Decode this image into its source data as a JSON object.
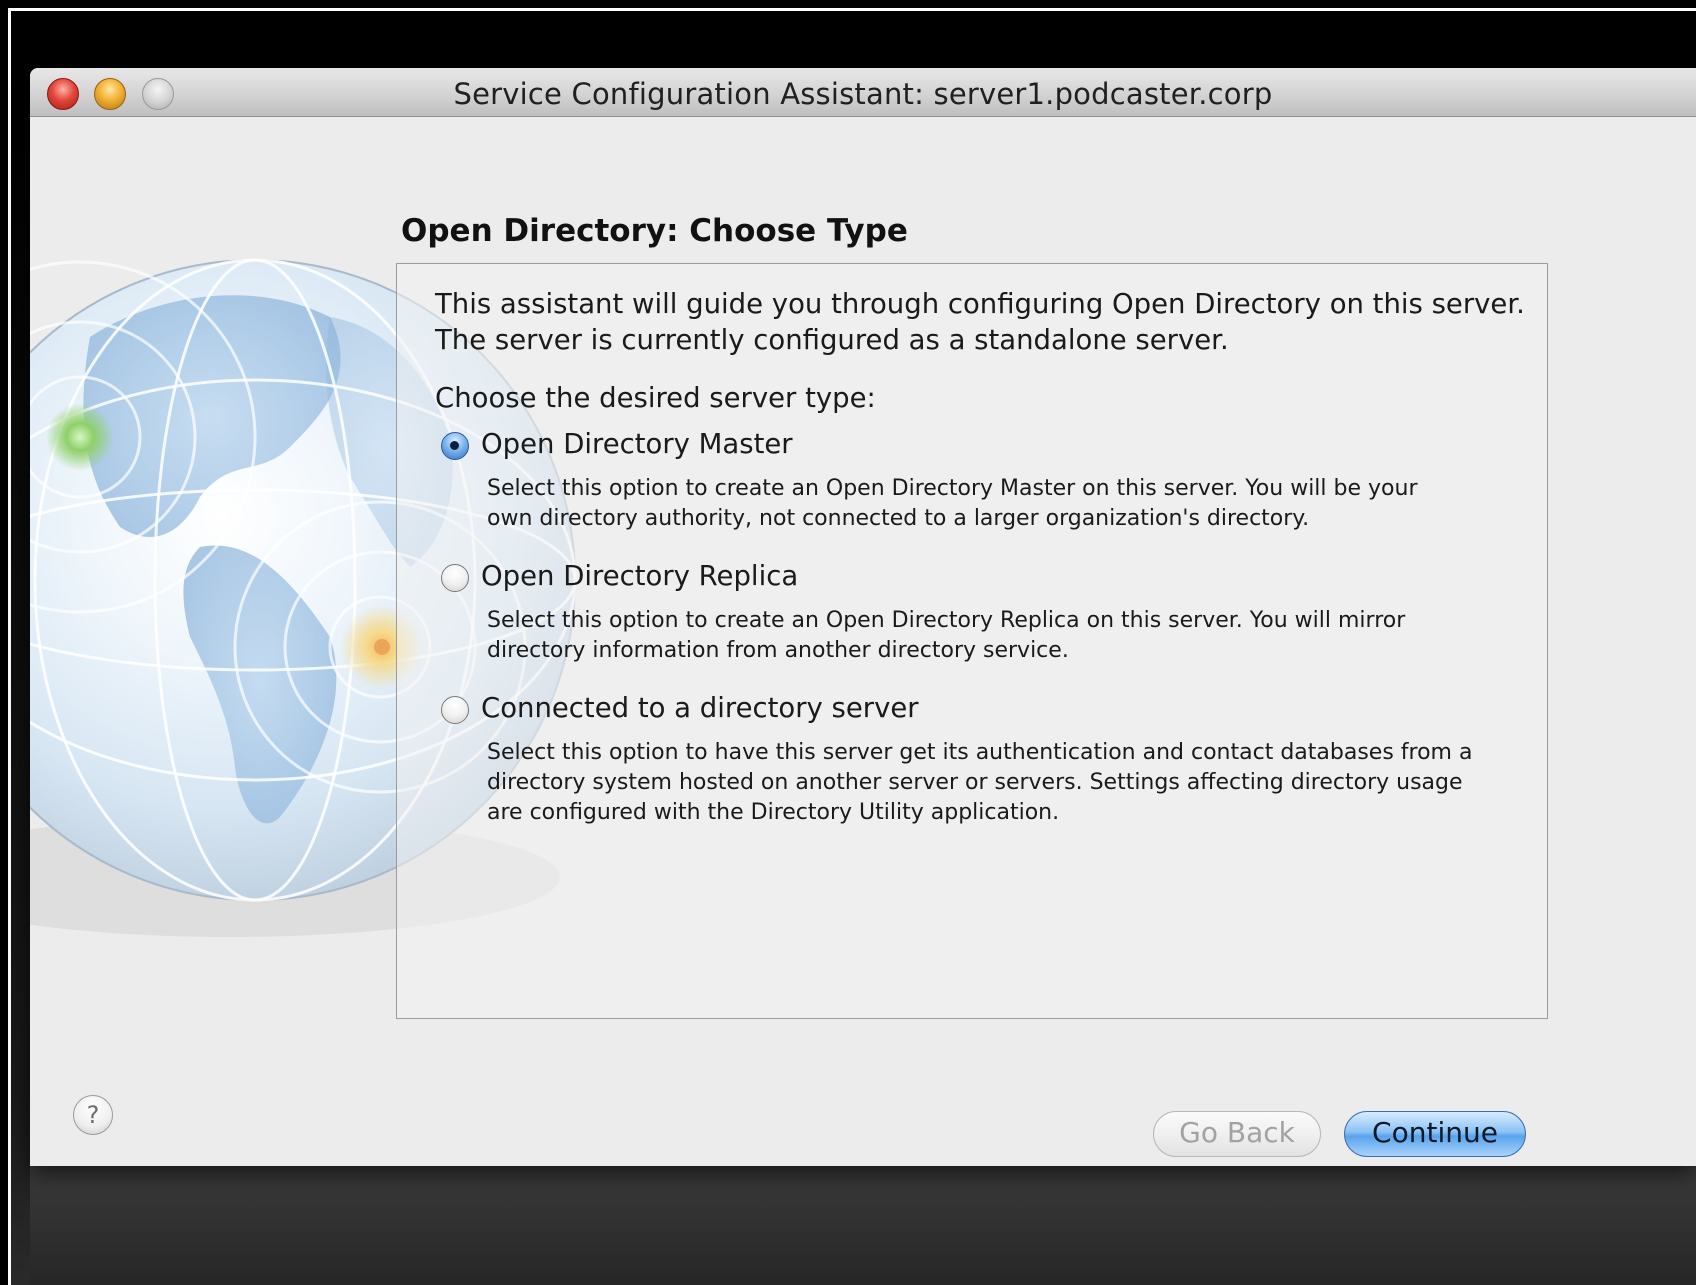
{
  "window": {
    "title": "Service Configuration Assistant: server1.podcaster.corp"
  },
  "page": {
    "title": "Open Directory: Choose Type",
    "intro_line1": "This assistant will guide you through configuring Open Directory on this server.",
    "intro_line2": "The server is currently configured as a standalone server.",
    "choose_label": "Choose the desired server type:"
  },
  "options": [
    {
      "label": "Open Directory Master",
      "selected": true,
      "desc_line1": "Select this option to create an Open Directory Master on this server.  You will be your",
      "desc_line2": "own directory authority, not connected to a larger organization's directory."
    },
    {
      "label": "Open Directory Replica",
      "selected": false,
      "desc_line1": "Select this option to create an Open Directory Replica on this server.  You will mirror",
      "desc_line2": "directory information from another directory service."
    },
    {
      "label": "Connected to a directory server",
      "selected": false,
      "desc_line1": "Select this option to have this server get its authentication and contact databases from a",
      "desc_line2": "directory system hosted on another server or servers.  Settings affecting directory usage",
      "desc_line3": "are configured with the Directory Utility application."
    }
  ],
  "footer": {
    "help_glyph": "?",
    "back_label": "Go Back",
    "continue_label": "Continue"
  },
  "icons": {
    "close": "close-traffic-light",
    "minimize": "minimize-traffic-light",
    "zoom": "zoom-traffic-light",
    "globe": "network-globe-graphic"
  },
  "colors": {
    "accent": "#5aa3ec",
    "window_bg": "#ececec"
  }
}
